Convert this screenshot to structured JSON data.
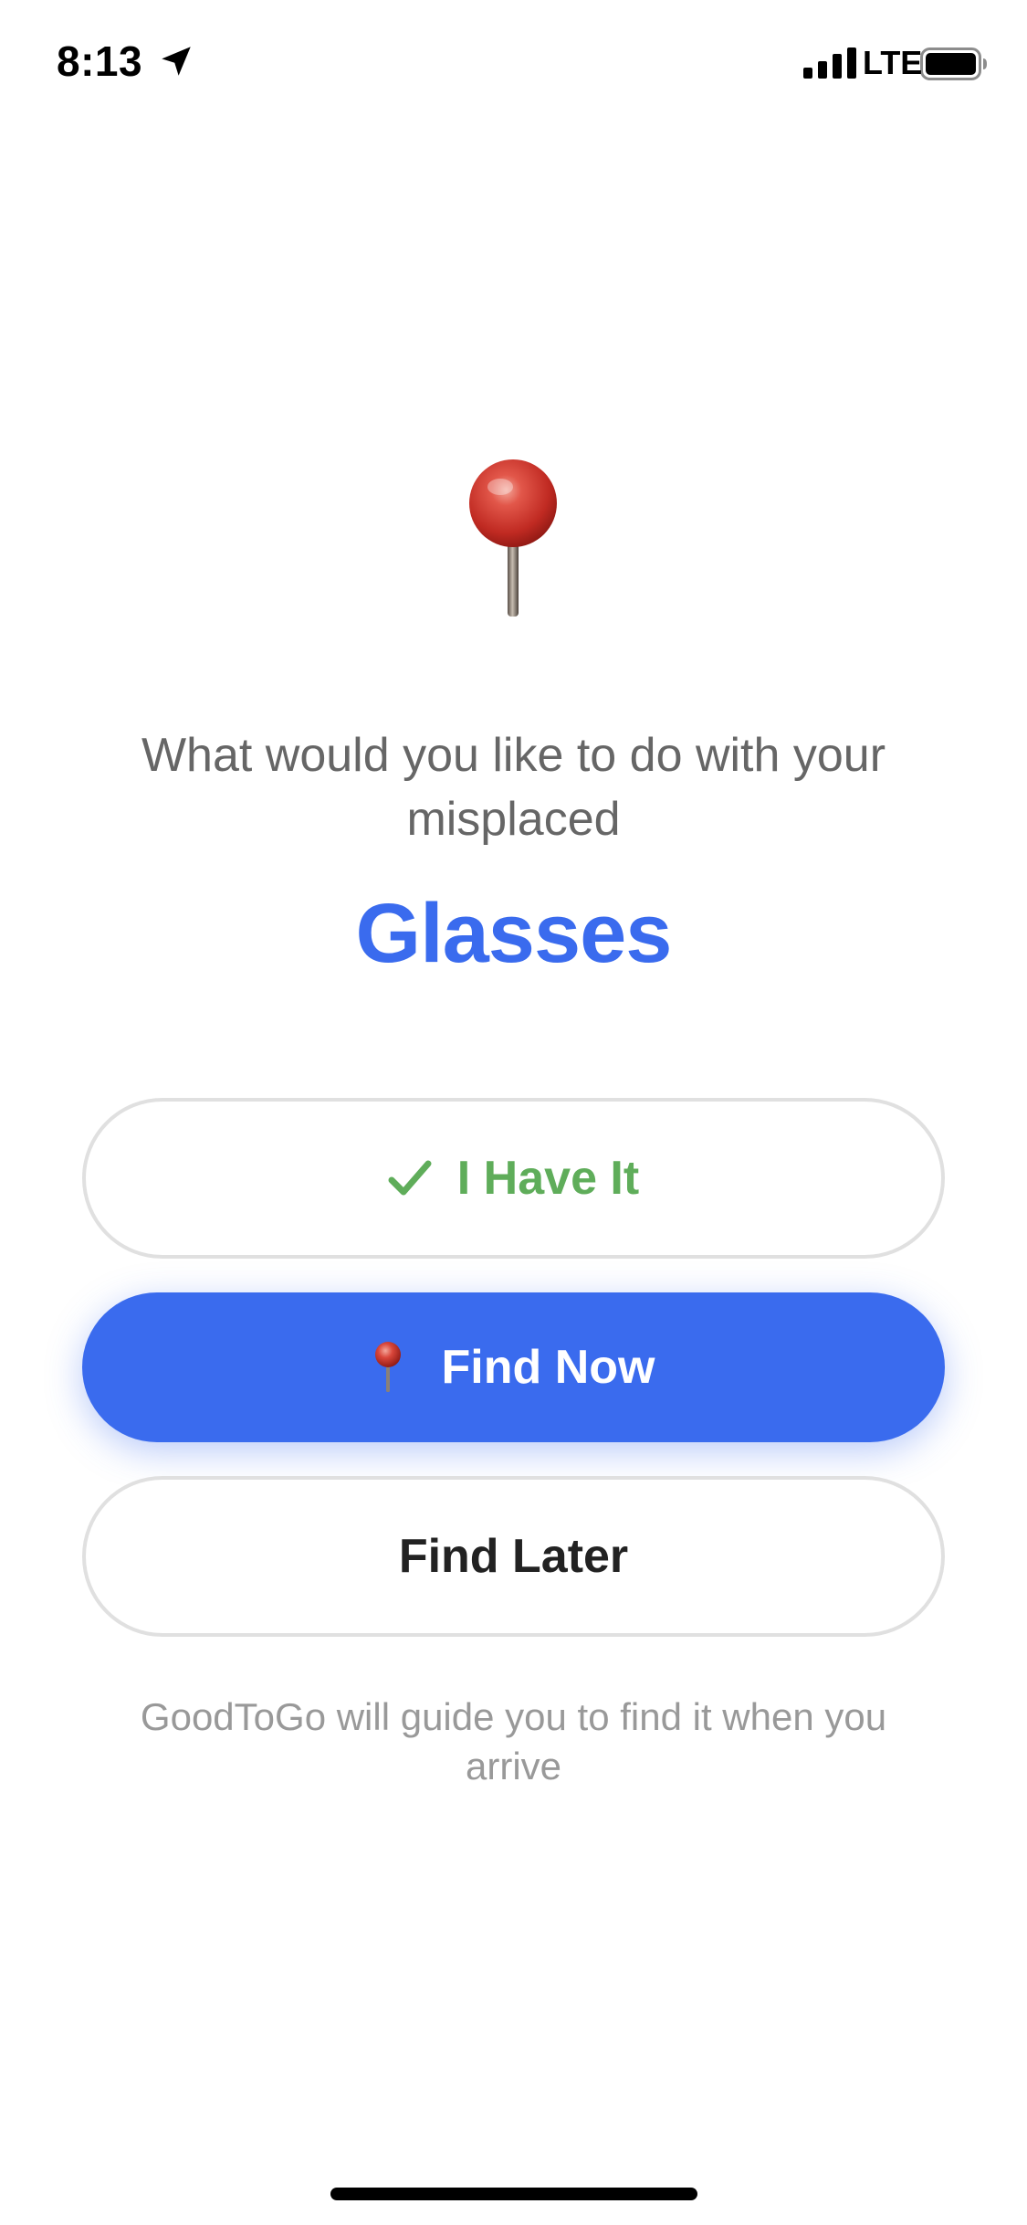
{
  "status_bar": {
    "time": "8:13",
    "network": "LTE",
    "icons": [
      "location-arrow-icon",
      "signal-icon",
      "battery-icon"
    ]
  },
  "illustration": "pushpin-icon",
  "prompt": {
    "text": "What would you like to do with your misplaced",
    "item_name": "Glasses"
  },
  "actions": {
    "have_it_label": "I Have It",
    "find_now_label": "Find Now",
    "find_later_label": "Find Later"
  },
  "hint": "GoodToGo will guide you to find it when you arrive",
  "colors": {
    "accent": "#3a6bee",
    "success": "#5fad5a",
    "muted_text": "#666666",
    "hint_text": "#999999",
    "border": "#e0e0e0"
  }
}
